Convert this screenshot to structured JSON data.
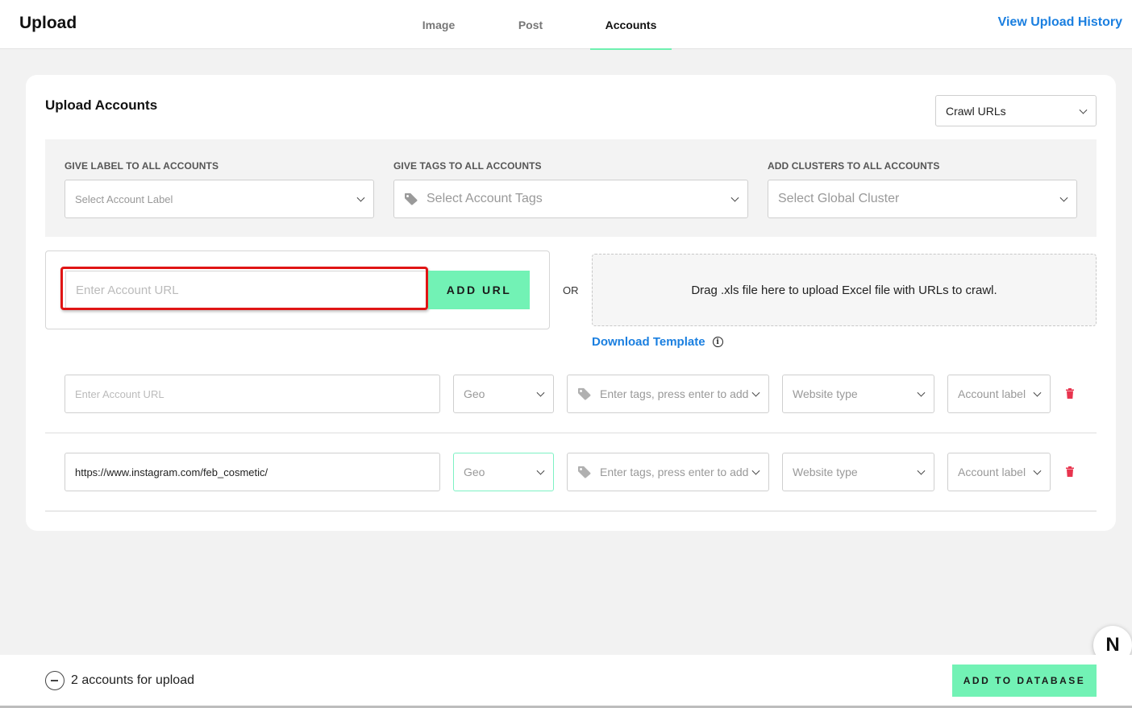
{
  "header": {
    "title": "Upload",
    "tabs": [
      {
        "label": "Image",
        "active": false
      },
      {
        "label": "Post",
        "active": false
      },
      {
        "label": "Accounts",
        "active": true
      }
    ],
    "history_link": "View Upload History"
  },
  "card": {
    "title": "Upload Accounts",
    "mode_select": "Crawl URLs",
    "settings": {
      "label_heading": "GIVE LABEL TO ALL ACCOUNTS",
      "label_placeholder": "Select Account Label",
      "tags_heading": "GIVE TAGS TO ALL ACCOUNTS",
      "tags_placeholder": "Select Account Tags",
      "clusters_heading": "ADD CLUSTERS TO ALL ACCOUNTS",
      "clusters_placeholder": "Select Global Cluster"
    },
    "add_url": {
      "placeholder": "Enter Account URL",
      "button": "ADD URL"
    },
    "or_label": "OR",
    "drop_zone_text": "Drag .xls file here to upload Excel file with URLs to crawl.",
    "download_template": "Download Template",
    "rows": [
      {
        "url": "",
        "url_placeholder": "Enter Account URL",
        "geo": "Geo",
        "tags_placeholder": "Enter tags, press enter to add",
        "website_type": "Website type",
        "account_label": "Account label"
      },
      {
        "url": "https://www.instagram.com/feb_cosmetic/",
        "url_placeholder": "Enter Account URL",
        "geo": "Geo",
        "tags_placeholder": "Enter tags, press enter to add",
        "website_type": "Website type",
        "account_label": "Account label"
      }
    ]
  },
  "footer": {
    "count_text": "2 accounts for upload",
    "add_button": "ADD TO DATABASE"
  },
  "bubble_letter": "N",
  "colors": {
    "accent_green": "#72f2b5",
    "link_blue": "#1a7fe0",
    "highlight_red": "#e01515",
    "trash_red": "#e8344e"
  }
}
